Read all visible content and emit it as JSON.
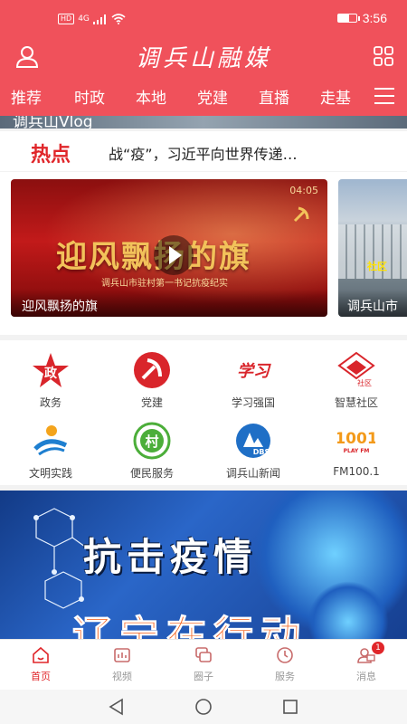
{
  "status_bar": {
    "network_badge": "HD",
    "signal_label": "4G",
    "time": "3:56"
  },
  "header": {
    "logo_text": "调兵山融媒",
    "channels": [
      "推荐",
      "时政",
      "本地",
      "党建",
      "直播",
      "走基"
    ],
    "icons": {
      "user": "user-icon",
      "apps": "apps-grid-icon",
      "menu": "hamburger-menu-icon"
    }
  },
  "peek_strip": {
    "text": "调兵山Vlog"
  },
  "hotline": {
    "label": "热点",
    "headline": "战“疫”，习近平向世界传递…"
  },
  "carousel": {
    "items": [
      {
        "caption": "迎风飘扬的旗",
        "overlay_title": "迎风飘扬的旗",
        "overlay_subtitle": "调兵山市驻村第一书记抗疫纪实",
        "duration": "04:05"
      },
      {
        "caption": "调兵山市",
        "overlay_tag": "社区"
      }
    ]
  },
  "services": [
    {
      "label": "政务",
      "icon": "government-star-icon"
    },
    {
      "label": "党建",
      "icon": "party-emblem-icon"
    },
    {
      "label": "学习强国",
      "icon": "xuexi-qiangguo-icon"
    },
    {
      "label": "智慧社区",
      "icon": "smart-community-icon"
    },
    {
      "label": "文明实践",
      "icon": "civilization-practice-icon"
    },
    {
      "label": "便民服务",
      "icon": "convenience-service-icon"
    },
    {
      "label": "调兵山新闻",
      "icon": "diaobingshan-news-icon"
    },
    {
      "label": "FM100.1",
      "icon": "fm-radio-icon"
    }
  ],
  "service_icon_text": {
    "gov": "政",
    "xuexi": "学习",
    "community": "社区",
    "convenience": "村",
    "news": "DBS",
    "fm_number": "1001",
    "fm_sub": "PLAY FM"
  },
  "banner": {
    "title": "抗击疫情",
    "subtitle": "辽宁在行动"
  },
  "tabbar": {
    "tabs": [
      {
        "label": "首页",
        "icon": "home-icon",
        "active": true
      },
      {
        "label": "视频",
        "icon": "video-icon",
        "active": false
      },
      {
        "label": "圈子",
        "icon": "circle-chat-icon",
        "active": false
      },
      {
        "label": "服务",
        "icon": "clock-service-icon",
        "active": false
      },
      {
        "label": "消息",
        "icon": "message-icon",
        "active": false,
        "badge": "1"
      }
    ]
  },
  "colors": {
    "brand_red": "#f0515b",
    "accent_red": "#e0262a",
    "banner_blue": "#2a66c8"
  }
}
